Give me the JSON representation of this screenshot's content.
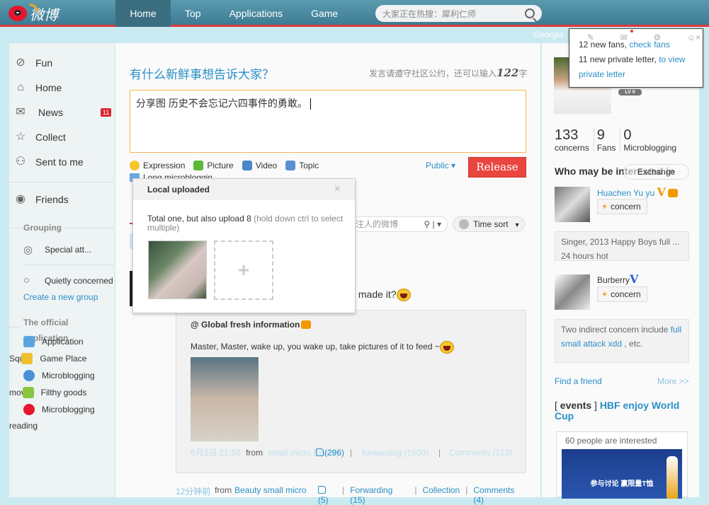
{
  "topbar": {
    "logo_text": "微博",
    "nav": [
      "Home",
      "Top",
      "Applications",
      "Game"
    ],
    "active_nav": "Home",
    "search_placeholder": "大家正在热搜：犀利仁师",
    "location": "Georgia"
  },
  "notification": {
    "fans_count_text": "12 new fans,",
    "fans_link": "check fans",
    "letter_text": "11 new private letter,",
    "letter_link": "to view private letter",
    "icons": [
      "edit-icon",
      "mail-icon",
      "gear-icon",
      "user-icon"
    ],
    "close": "×"
  },
  "sidebar": {
    "items": [
      {
        "label": "Fun",
        "icon": "compass-icon"
      },
      {
        "label": "Home",
        "icon": "home-icon"
      },
      {
        "label": "News",
        "icon": "mail-icon",
        "badge": "11"
      },
      {
        "label": "Collect",
        "icon": "star-icon"
      },
      {
        "label": "Sent to me",
        "icon": "user-icon"
      }
    ],
    "friends": "Friends",
    "grouping_label": "Grouping",
    "special": "Special att...",
    "quietly": "Quietly concerned",
    "create_group": "Create a new group",
    "official_label": "The official application",
    "apps": [
      {
        "label": "Application",
        "prefix": ""
      },
      {
        "label": "Game Place",
        "prefix": "Squ"
      },
      {
        "label": "Microblogging",
        "prefix": ""
      },
      {
        "label": "Filthy goods",
        "prefix": "mov"
      },
      {
        "label": "Microblogging",
        "prefix": ""
      }
    ],
    "reading": "reading"
  },
  "compose": {
    "title": "有什么新鲜事想告诉大家？",
    "hint_prefix": "发言请遵守社区公约，还可以输入",
    "remaining": "122",
    "hint_suffix": "字",
    "text": "分享图 历史不会忘记六四事件的勇敢。",
    "tools": [
      "Expression",
      "Picture",
      "Video",
      "Topic"
    ],
    "long_microblog": "Long microbloggin",
    "visibility": "Public ▾",
    "release": "Release"
  },
  "upload_popup": {
    "title": "Local uploaded",
    "close": "×",
    "message": "Total one, but also upload 8",
    "hint": "(hold down ctrl to select multiple)",
    "add": "+"
  },
  "feed_filter": {
    "search_placeholder": "注人的微博",
    "sort": "Time sort"
  },
  "feed": {
    "fragment": "s made it?",
    "forwarded": {
      "author": "@ Global fresh information",
      "text": "Master, Master, wake up, you wake up, take pictures of it to feed ~",
      "time": "6月3日 21:50",
      "from_label": "from",
      "source": "small micro Beauty",
      "likes": "(296)",
      "forwarding": "forwarding (1500)",
      "comments": "Comments (123)"
    },
    "meta": {
      "time": "12分钟前",
      "from_label": "from",
      "source": "Beauty small micro",
      "likes": "(5)",
      "forwarding": "Forwarding (15)",
      "collection": "Collection",
      "comments": "Comments (4)"
    }
  },
  "profile": {
    "level": "LV 0",
    "stats": [
      {
        "value": "133",
        "label": "concerns"
      },
      {
        "value": "9",
        "label": "Fans"
      },
      {
        "value": "0",
        "label": "Microblogging"
      }
    ]
  },
  "recommend": {
    "title": "Who may be interested in",
    "change": "Exchange",
    "users": [
      {
        "name": "Huachen Yu yu",
        "follow": "concern",
        "tip": "Singer, 2013 Happy Boys full ... 24 hours hot"
      },
      {
        "name": "Burberry",
        "follow": "concern",
        "tip_prefix": "Two indirect concern include",
        "tip_link": "full small attack xdd",
        "tip_suffix": ", etc."
      }
    ],
    "find_friend": "Find a friend",
    "more": "More >>"
  },
  "events": {
    "bracket_open": "[",
    "label": "events",
    "bracket_close": "]",
    "title": "HBF enjoy World Cup",
    "interested": "60 people are interested",
    "ad_text": "参与讨论 赢限量T恤"
  }
}
